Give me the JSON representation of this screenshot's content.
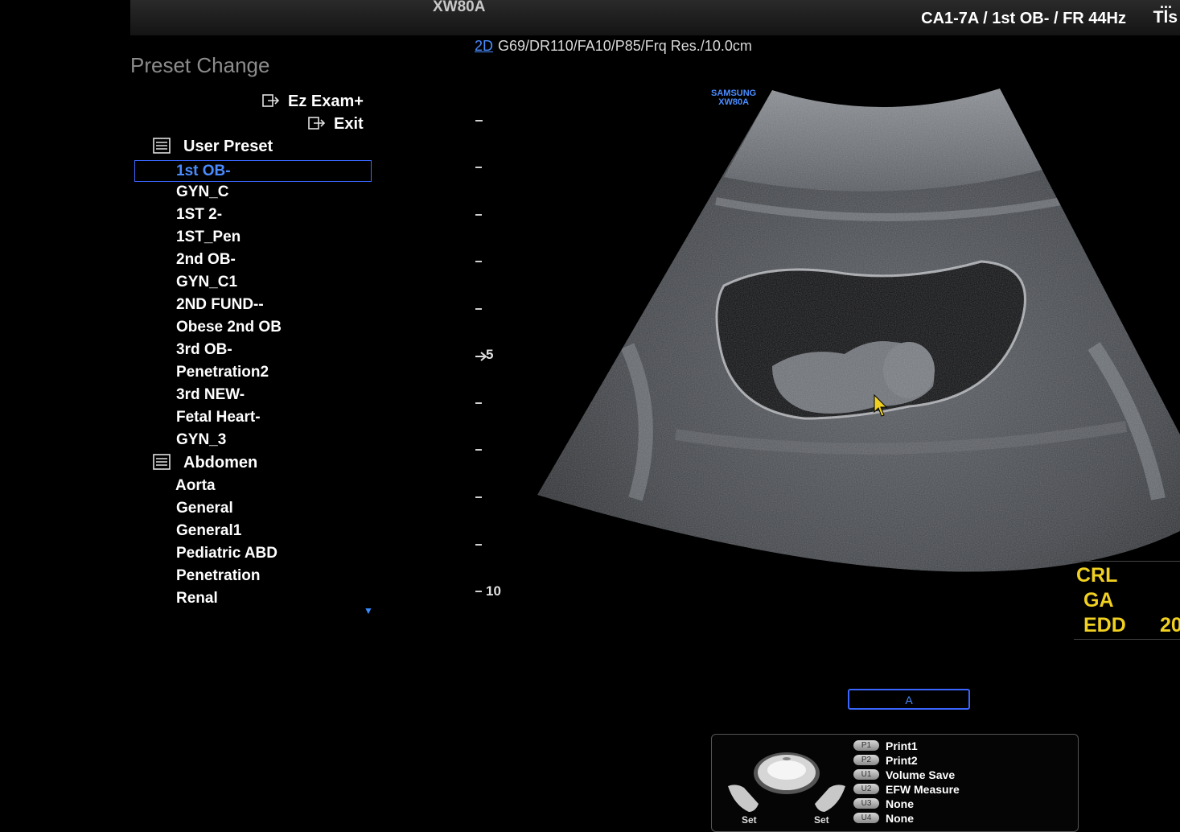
{
  "header": {
    "model": "XW80A",
    "probe_info": "CA1-7A / 1st OB- / FR 44Hz",
    "tools_label": "Tls",
    "tools_dots": "..."
  },
  "imaging": {
    "mode": "2D",
    "params": "G69/DR110/FA10/P85/Frq Res./10.0cm",
    "brand_line1": "SAMSUNG",
    "brand_line2": "XW80A"
  },
  "depth_scale": {
    "mid_label": "5",
    "max_label": "10"
  },
  "preset_panel": {
    "title": "Preset Change",
    "ez_exam_label": "Ez Exam+",
    "exit_label": "Exit",
    "groups": [
      {
        "label": "User Preset",
        "items": [
          "1st OB-",
          "GYN_C",
          "1ST 2-",
          "1ST_Pen",
          "2nd OB-",
          "GYN_C1",
          "2ND FUND--",
          "Obese 2nd OB",
          "3rd OB-",
          "Penetration2",
          "3rd NEW-",
          "Fetal Heart-",
          "GYN_3"
        ]
      },
      {
        "label": "Abdomen",
        "items": [
          "Aorta",
          "General",
          "General1",
          "Pediatric ABD",
          "Penetration",
          "Renal"
        ]
      }
    ],
    "selected": "1st OB-"
  },
  "measurements": {
    "crl_label": "CRL",
    "ga_label": "GA",
    "edd_label": "EDD",
    "edd_value_partial": "20"
  },
  "body_marker_button": "A",
  "control_panel": {
    "set_left": "Set",
    "set_right": "Set",
    "keys": [
      {
        "key": "P1",
        "label": "Print1"
      },
      {
        "key": "P2",
        "label": "Print2"
      },
      {
        "key": "U1",
        "label": "Volume Save"
      },
      {
        "key": "U2",
        "label": "EFW Measure"
      },
      {
        "key": "U3",
        "label": "None"
      },
      {
        "key": "U4",
        "label": "None"
      }
    ]
  },
  "colors": {
    "accent_blue": "#4a8cff",
    "selection_border": "#3a66ff",
    "measurement_yellow": "#f0d020"
  }
}
